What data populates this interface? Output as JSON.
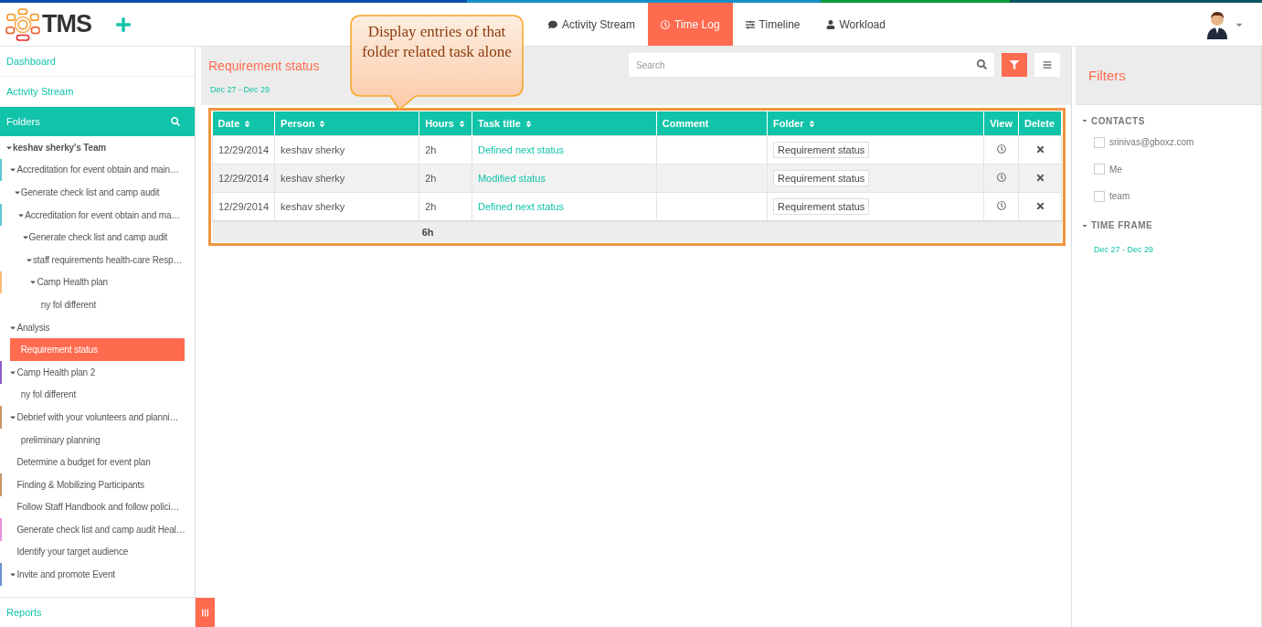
{
  "header": {
    "logo": "TMS",
    "nav_tabs": [
      {
        "label": "Activity Stream",
        "selected": false
      },
      {
        "label": "Time Log",
        "selected": true
      },
      {
        "label": "Timeline",
        "selected": false
      },
      {
        "label": "Workload",
        "selected": false
      }
    ]
  },
  "callout": "Display entries of that folder related task alone",
  "sidebar": {
    "nav": [
      "Dashboard",
      "Activity Stream"
    ],
    "folders_title": "Folders",
    "tree": [
      {
        "label": "keshav sherky's Team",
        "expanded": true,
        "selected": false,
        "children": [
          {
            "label": "Accreditation for event obtain and main…",
            "expanded": true,
            "selected": false,
            "color": "#5bc8d4",
            "children": [
              {
                "label": "Generate check list and camp audit",
                "expanded": true,
                "selected": false,
                "children": [
                  {
                    "label": "Accreditation for event obtain and ma…",
                    "expanded": true,
                    "selected": false,
                    "color": "#5bc8d4",
                    "children": [
                      {
                        "label": "Generate check list and camp audit",
                        "expanded": true,
                        "selected": false,
                        "children": [
                          {
                            "label": "staff requirements health-care Resp…",
                            "expanded": true,
                            "selected": false,
                            "children": [
                              {
                                "label": "Camp Health plan",
                                "expanded": true,
                                "selected": false,
                                "color": "#f8b87a",
                                "children": [
                                  {
                                    "label": "ny fol different",
                                    "selected": false
                                  }
                                ]
                              }
                            ]
                          }
                        ]
                      }
                    ]
                  }
                ]
              }
            ]
          },
          {
            "label": "Analysis",
            "expanded": true,
            "selected": false,
            "children": [
              {
                "label": "Requirement status",
                "selected": true
              }
            ]
          },
          {
            "label": "Camp Health plan 2",
            "expanded": true,
            "selected": false,
            "color": "#8e5ec8",
            "children": [
              {
                "label": "ny fol different",
                "selected": false
              }
            ]
          },
          {
            "label": "Debrief with your volunteers and planni…",
            "expanded": true,
            "selected": false,
            "color": "#c8956a",
            "children": [
              {
                "label": "preliminary planning",
                "selected": false
              }
            ]
          },
          {
            "label": "Determine a budget for event plan",
            "selected": false
          },
          {
            "label": "Finding & Mobilizing Participants",
            "selected": false,
            "color": "#c8956a"
          },
          {
            "label": "Follow Staff Handbook and follow polici…",
            "selected": false
          },
          {
            "label": "Generate check list and camp audit Heal…",
            "selected": false,
            "color": "#e58fd9"
          },
          {
            "label": "Identify your target audience",
            "selected": false
          },
          {
            "label": "Invite and promote Event",
            "expanded": true,
            "selected": false,
            "color": "#6d8fd0"
          }
        ]
      }
    ],
    "footer": "Reports"
  },
  "main": {
    "title": "Requirement status",
    "date_range": "Dec 27 - Dec 29",
    "search": {
      "placeholder": "Search"
    },
    "table": {
      "columns": [
        {
          "label": "Date",
          "sortable": true
        },
        {
          "label": "Person",
          "sortable": true
        },
        {
          "label": "Hours",
          "sortable": true
        },
        {
          "label": "Task title",
          "sortable": true
        },
        {
          "label": "Comment",
          "sortable": false
        },
        {
          "label": "Folder",
          "sortable": true
        },
        {
          "label": "View",
          "sortable": false
        },
        {
          "label": "Delete",
          "sortable": false
        }
      ],
      "rows": [
        {
          "date": "12/29/2014",
          "person": "keshav sherky",
          "hours": "2h",
          "task_title": "Defined next status",
          "folder": "Requirement status"
        },
        {
          "date": "12/29/2014",
          "person": "keshav sherky",
          "hours": "2h",
          "task_title": "Modified status",
          "folder": "Requirement status"
        },
        {
          "date": "12/29/2014",
          "person": "keshav sherky",
          "hours": "2h",
          "task_title": "Defined next status",
          "folder": "Requirement status"
        }
      ],
      "total_hours": "6h"
    }
  },
  "filters": {
    "title": "Filters",
    "sections": [
      {
        "kind": "checkboxes",
        "title": "CONTACTS",
        "items": [
          {
            "label": "srinivas@gboxz.com",
            "checked": false
          },
          {
            "label": "Me",
            "checked": false
          },
          {
            "label": "team",
            "checked": false
          }
        ]
      },
      {
        "kind": "range",
        "title": "TIME FRAME",
        "value": "Dec 27 - Dec 29"
      }
    ]
  }
}
